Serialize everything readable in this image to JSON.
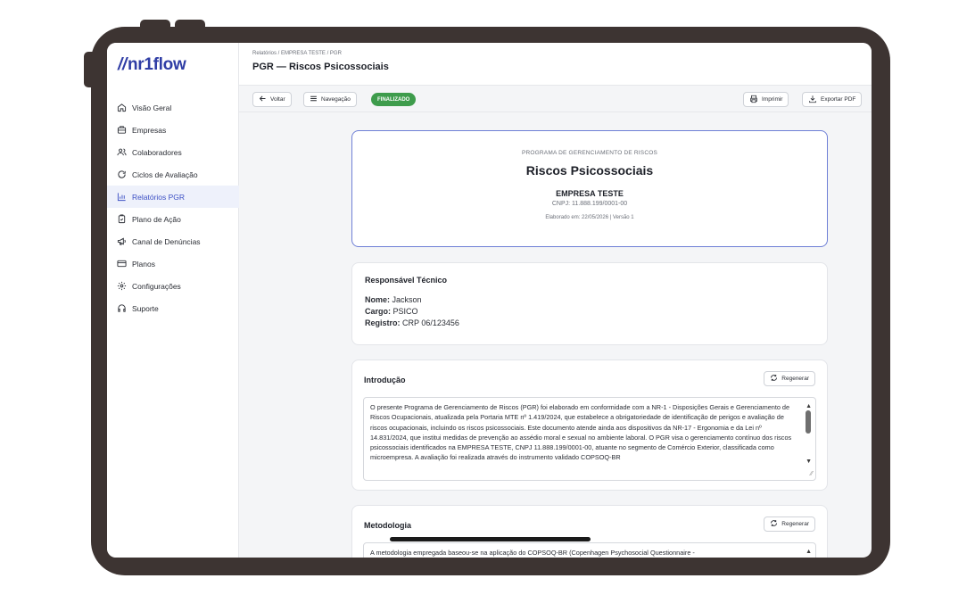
{
  "app": {
    "logo": "nr1flow",
    "logo_prefix": "//"
  },
  "sidebar": {
    "items": [
      {
        "label": "Visão Geral",
        "icon": "home-icon"
      },
      {
        "label": "Empresas",
        "icon": "building-icon"
      },
      {
        "label": "Colaboradores",
        "icon": "users-icon"
      },
      {
        "label": "Ciclos de Avaliação",
        "icon": "refresh-icon"
      },
      {
        "label": "Relatórios PGR",
        "icon": "bar-chart-icon",
        "active": true
      },
      {
        "label": "Plano de Ação",
        "icon": "clipboard-icon"
      },
      {
        "label": "Canal de Denúncias",
        "icon": "megaphone-icon"
      },
      {
        "label": "Planos",
        "icon": "credit-card-icon"
      },
      {
        "label": "Configurações",
        "icon": "gear-icon"
      },
      {
        "label": "Suporte",
        "icon": "headset-icon"
      }
    ]
  },
  "header": {
    "breadcrumb": "Relatórios / EMPRESA TESTE / PGR",
    "title": "PGR — Riscos Psicossociais"
  },
  "toolbar": {
    "back": "Voltar",
    "navigation": "Navegação",
    "status": "FINALIZADO",
    "print": "Imprimir",
    "export": "Exportar PDF"
  },
  "cover": {
    "kicker": "PROGRAMA DE GERENCIAMENTO DE RISCOS",
    "title": "Riscos Psicossociais",
    "company": "EMPRESA TESTE",
    "cnpj": "CNPJ: 11.888.199/0001-00",
    "elaborated": "Elaborado em: 22/05/2026 | Versão 1"
  },
  "responsible": {
    "title": "Responsável Técnico",
    "name_label": "Nome:",
    "name": "Jackson",
    "role_label": "Cargo:",
    "role": "PSICO",
    "reg_label": "Registro:",
    "reg": "CRP 06/123456"
  },
  "introduction": {
    "title": "Introdução",
    "regen": "Regenerar",
    "text": "O presente Programa de Gerenciamento de Riscos (PGR) foi elaborado em conformidade com a NR-1 - Disposições Gerais e Gerenciamento de Riscos Ocupacionais, atualizada pela Portaria MTE nº 1.419/2024, que estabelece a obrigatoriedade de identificação de perigos e avaliação de riscos ocupacionais, incluindo os riscos psicossociais. Este documento atende ainda aos dispositivos da NR-17 - Ergonomia e da Lei nº 14.831/2024, que institui medidas de prevenção ao assédio moral e sexual no ambiente laboral. O PGR visa o gerenciamento contínuo dos riscos psicossociais identificados na EMPRESA TESTE, CNPJ 11.888.199/0001-00, atuante no segmento de Comércio Exterior, classificada como microempresa. A avaliação foi realizada através do instrumento validado COPSOQ-BR"
  },
  "methodology": {
    "title": "Metodologia",
    "regen": "Regenerar",
    "text": "A metodologia empregada baseou-se na aplicação do COPSOQ-BR (Copenhagen Psychosocial Questionnaire -"
  }
}
